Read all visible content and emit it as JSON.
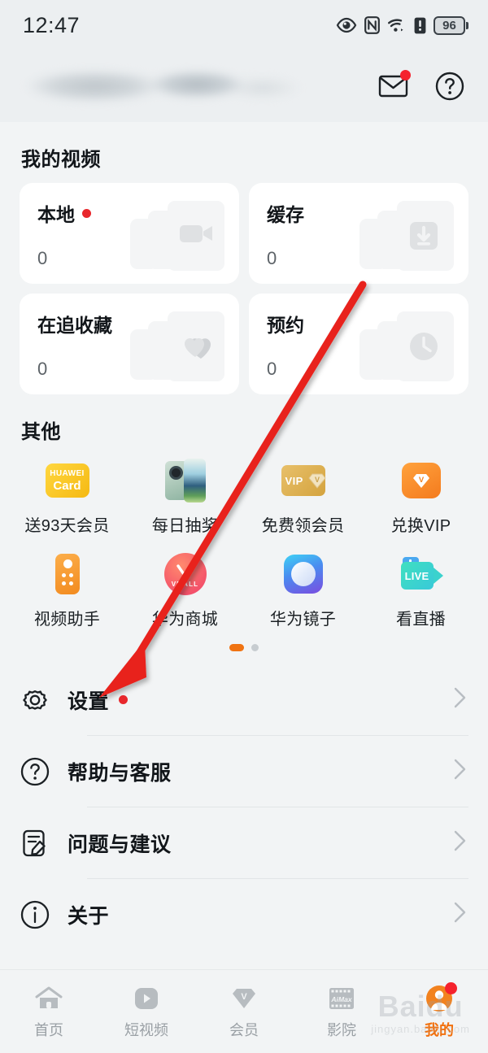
{
  "status_bar": {
    "time": "12:47",
    "battery_percent": "96",
    "icons": [
      "eye-comfort-icon",
      "nfc-icon",
      "wifi-icon",
      "sim-alert-icon",
      "battery-icon"
    ]
  },
  "header": {
    "username_masked": "",
    "mail_icon": "mail-icon",
    "mail_has_badge": true,
    "help_icon": "help-circle-icon"
  },
  "my_videos": {
    "title": "我的视频",
    "cards": [
      {
        "label": "本地",
        "count": "0",
        "icon": "video-camera-icon",
        "badge": true
      },
      {
        "label": "缓存",
        "count": "0",
        "icon": "download-icon",
        "badge": false
      },
      {
        "label": "在追收藏",
        "count": "0",
        "icon": "heart-icon",
        "badge": false
      },
      {
        "label": "预约",
        "count": "0",
        "icon": "clock-icon",
        "badge": false
      }
    ]
  },
  "other": {
    "title": "其他",
    "items": [
      {
        "label": "送93天会员",
        "icon": "huawei-card-icon"
      },
      {
        "label": "每日抽奖",
        "icon": "phone-product-icon"
      },
      {
        "label": "免费领会员",
        "icon": "vip-card-icon"
      },
      {
        "label": "兑换VIP",
        "icon": "vip-redeem-icon"
      },
      {
        "label": "视频助手",
        "icon": "remote-control-icon"
      },
      {
        "label": "华为商城",
        "icon": "vmall-icon"
      },
      {
        "label": "华为镜子",
        "icon": "mirror-icon"
      },
      {
        "label": "看直播",
        "icon": "live-icon"
      }
    ],
    "pager": {
      "pages": 2,
      "active": 1
    },
    "vmall_wordmark": "VMALL",
    "huawei_card_line1": "HUAWEI",
    "huawei_card_line2": "Card",
    "vip_label": "VIP",
    "live_label": "LIVE",
    "aimax_label": "AiMax"
  },
  "settings_list": [
    {
      "label": "设置",
      "icon": "gear-icon",
      "badge": true,
      "chevron": "chevron-right-icon"
    },
    {
      "label": "帮助与客服",
      "icon": "help-circle-icon",
      "badge": false,
      "chevron": "chevron-right-icon"
    },
    {
      "label": "问题与建议",
      "icon": "feedback-icon",
      "badge": false,
      "chevron": "chevron-right-icon"
    },
    {
      "label": "关于",
      "icon": "info-icon",
      "badge": false,
      "chevron": "chevron-right-icon"
    }
  ],
  "bottom_nav": [
    {
      "label": "首页",
      "icon": "home-icon",
      "active": false,
      "badge": false
    },
    {
      "label": "短视频",
      "icon": "play-square-icon",
      "active": false,
      "badge": false
    },
    {
      "label": "会员",
      "icon": "vip-diamond-icon",
      "active": false,
      "badge": false
    },
    {
      "label": "影院",
      "icon": "film-aimax-icon",
      "active": false,
      "badge": false
    },
    {
      "label": "我的",
      "icon": "user-avatar-icon",
      "active": true,
      "badge": true
    }
  ],
  "watermark": {
    "line1": "Baidu",
    "line2": "jingyan.baidu.com"
  },
  "annotation": {
    "type": "arrow",
    "color": "#e8201f",
    "points_to": "设置"
  },
  "colors": {
    "accent": "#f2700d",
    "badge_red": "#e8272c",
    "page_bg": "#f2f4f5",
    "card_bg": "#ffffff",
    "header_bg": "#eceff1"
  }
}
